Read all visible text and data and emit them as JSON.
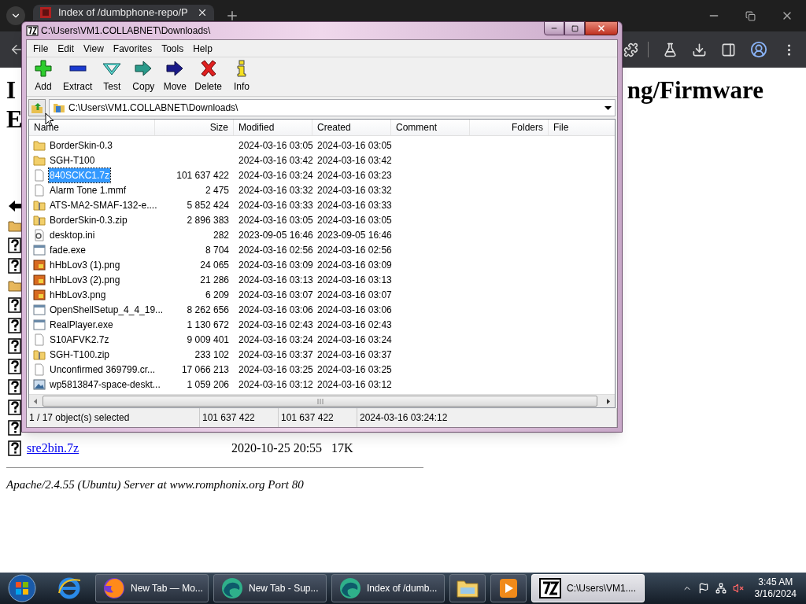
{
  "browser": {
    "tab": {
      "title": "Index of /dumbphone-repo/P"
    },
    "page": {
      "heading": {
        "line_1": "I",
        "line_2": "E",
        "right": "ng/Firmware"
      },
      "listing_icons": [
        {
          "kind": "back"
        },
        {
          "kind": "folder"
        },
        {
          "kind": "unknown"
        },
        {
          "kind": "unknown"
        },
        {
          "kind": "folder"
        },
        {
          "kind": "unknown"
        },
        {
          "kind": "unknown"
        },
        {
          "kind": "unknown"
        },
        {
          "kind": "unknown"
        },
        {
          "kind": "unknown"
        },
        {
          "kind": "unknown"
        },
        {
          "kind": "unknown"
        }
      ],
      "last_entry": {
        "kind": "unknown",
        "name": "sre2bin.7z",
        "date": "2020-10-25 20:55",
        "size": "17K"
      },
      "footer": "Apache/2.4.55 (Ubuntu) Server at www.romphonix.org Port 80"
    }
  },
  "archiver": {
    "title": "C:\\Users\\VM1.COLLABNET\\Downloads\\",
    "menu": [
      "File",
      "Edit",
      "View",
      "Favorites",
      "Tools",
      "Help"
    ],
    "toolbar": [
      {
        "kind": "add",
        "label": "Add"
      },
      {
        "kind": "extract",
        "label": "Extract"
      },
      {
        "kind": "test",
        "label": "Test"
      },
      {
        "kind": "copy",
        "label": "Copy"
      },
      {
        "kind": "move",
        "label": "Move"
      },
      {
        "kind": "delete",
        "label": "Delete"
      },
      {
        "kind": "info",
        "label": "Info"
      }
    ],
    "path": "C:\\Users\\VM1.COLLABNET\\Downloads\\",
    "columns": [
      "Name",
      "Size",
      "Modified",
      "Created",
      "Comment",
      "Folders",
      "File"
    ],
    "rows": [
      {
        "kind": "folder",
        "name": "BorderSkin-0.3",
        "modified": "2024-03-16 03:05",
        "created": "2024-03-16 03:05",
        "selected": false
      },
      {
        "kind": "folder",
        "name": "SGH-T100",
        "modified": "2024-03-16 03:42",
        "created": "2024-03-16 03:42",
        "selected": false
      },
      {
        "kind": "file",
        "name": "840SCKC1.7z",
        "size": "101 637 422",
        "modified": "2024-03-16 03:24",
        "created": "2024-03-16 03:23",
        "selected": true
      },
      {
        "kind": "file",
        "name": "Alarm Tone 1.mmf",
        "size": "2 475",
        "modified": "2024-03-16 03:32",
        "created": "2024-03-16 03:32",
        "selected": false
      },
      {
        "kind": "zip",
        "name": "ATS-MA2-SMAF-132-e....",
        "size": "5 852 424",
        "modified": "2024-03-16 03:33",
        "created": "2024-03-16 03:33",
        "selected": false
      },
      {
        "kind": "zip",
        "name": "BorderSkin-0.3.zip",
        "size": "2 896 383",
        "modified": "2024-03-16 03:05",
        "created": "2024-03-16 03:05",
        "selected": false
      },
      {
        "kind": "settings",
        "name": "desktop.ini",
        "size": "282",
        "modified": "2023-09-05 16:46",
        "created": "2023-09-05 16:46",
        "selected": false
      },
      {
        "kind": "exe",
        "name": "fade.exe",
        "size": "8 704",
        "modified": "2024-03-16 02:56",
        "created": "2024-03-16 02:56",
        "selected": false
      },
      {
        "kind": "image",
        "name": "hHbLov3 (1).png",
        "size": "24 065",
        "modified": "2024-03-16 03:09",
        "created": "2024-03-16 03:09",
        "selected": false
      },
      {
        "kind": "image",
        "name": "hHbLov3 (2).png",
        "size": "21 286",
        "modified": "2024-03-16 03:13",
        "created": "2024-03-16 03:13",
        "selected": false
      },
      {
        "kind": "image",
        "name": "hHbLov3.png",
        "size": "6 209",
        "modified": "2024-03-16 03:07",
        "created": "2024-03-16 03:07",
        "selected": false
      },
      {
        "kind": "exe",
        "name": "OpenShellSetup_4_4_19...",
        "size": "8 262 656",
        "modified": "2024-03-16 03:06",
        "created": "2024-03-16 03:06",
        "selected": false
      },
      {
        "kind": "exe",
        "name": "RealPlayer.exe",
        "size": "1 130 672",
        "modified": "2024-03-16 02:43",
        "created": "2024-03-16 02:43",
        "selected": false
      },
      {
        "kind": "file",
        "name": "S10AFVK2.7z",
        "size": "9 009 401",
        "modified": "2024-03-16 03:24",
        "created": "2024-03-16 03:24",
        "selected": false
      },
      {
        "kind": "zip",
        "name": "SGH-T100.zip",
        "size": "233 102",
        "modified": "2024-03-16 03:37",
        "created": "2024-03-16 03:37",
        "selected": false
      },
      {
        "kind": "file",
        "name": "Unconfirmed 369799.cr...",
        "size": "17 066 213",
        "modified": "2024-03-16 03:25",
        "created": "2024-03-16 03:25",
        "selected": false
      },
      {
        "kind": "photo",
        "name": "wp5813847-space-deskt...",
        "size": "1 059 206",
        "modified": "2024-03-16 03:12",
        "created": "2024-03-16 03:12",
        "selected": false
      }
    ],
    "status": [
      "1 / 17 object(s) selected",
      "101 637 422",
      "101 637 422",
      "2024-03-16 03:24:12"
    ]
  },
  "taskbar": {
    "buttons": [
      {
        "kind": "firefox",
        "label": "New Tab — Mo...",
        "selected": false
      },
      {
        "kind": "edge",
        "label": "New Tab - Sup...",
        "selected": false
      },
      {
        "kind": "edge",
        "label": "Index of /dumb...",
        "selected": false
      },
      {
        "kind": "explorer",
        "selected": false
      },
      {
        "kind": "media",
        "selected": false
      },
      {
        "kind": "sevenzip",
        "label": "C:\\Users\\VM1....",
        "selected": true
      }
    ],
    "clock": {
      "time": "3:45 AM",
      "date": "3/16/2024"
    }
  }
}
